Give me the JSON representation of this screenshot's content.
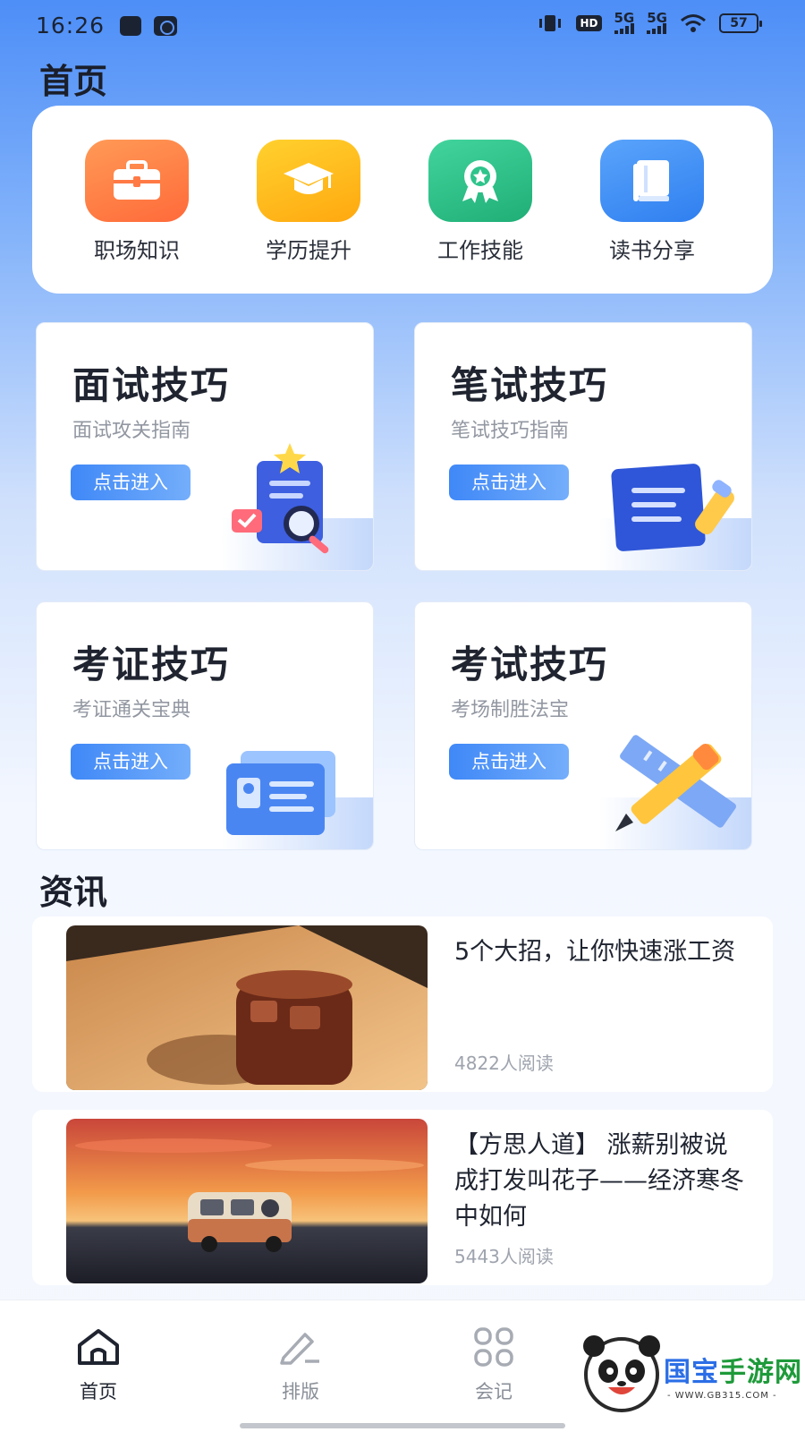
{
  "status_bar": {
    "time": "16:26",
    "hd": "HD",
    "net1": "5G",
    "net2": "5G",
    "battery": "57"
  },
  "page_title": "首页",
  "quick_entries": [
    {
      "label": "职场知识",
      "icon": "briefcase-icon",
      "color": "#ff7a45"
    },
    {
      "label": "学历提升",
      "icon": "graduation-cap-icon",
      "color": "#ffb820"
    },
    {
      "label": "工作技能",
      "icon": "award-badge-icon",
      "color": "#2ec48b"
    },
    {
      "label": "读书分享",
      "icon": "book-icon",
      "color": "#3d8ef6"
    }
  ],
  "tip_cards": [
    {
      "title": "面试技巧",
      "subtitle": "面试攻关指南",
      "button": "点击进入",
      "art": "resume-magnifier-icon"
    },
    {
      "title": "笔试技巧",
      "subtitle": "笔试技巧指南",
      "button": "点击进入",
      "art": "notebook-pencil-icon"
    },
    {
      "title": "考证技巧",
      "subtitle": "考证通关宝典",
      "button": "点击进入",
      "art": "id-card-icon"
    },
    {
      "title": "考试技巧",
      "subtitle": "考场制胜法宝",
      "button": "点击进入",
      "art": "pencil-ruler-icon"
    }
  ],
  "news_section_title": "资讯",
  "news": [
    {
      "title": "5个大招，让你快速涨工资",
      "reads": "4822人阅读",
      "image": "iced-tea-photo"
    },
    {
      "title": "【方思人道】 涨薪别被说成打发叫花子——经济寒冬中如何",
      "reads": "5443人阅读",
      "image": "sunset-van-photo"
    }
  ],
  "bottom_nav": [
    {
      "label": "首页",
      "icon": "home-icon",
      "active": true
    },
    {
      "label": "排版",
      "icon": "edit-icon",
      "active": false
    },
    {
      "label": "会记",
      "icon": "grid-icon",
      "active": false
    }
  ],
  "watermark": {
    "brand_a": "国宝",
    "brand_b": "手游网",
    "url": "- WWW.GB315.COM -"
  },
  "colors": {
    "accent": "#3f88f7",
    "background_top": "#4d8ef7"
  }
}
